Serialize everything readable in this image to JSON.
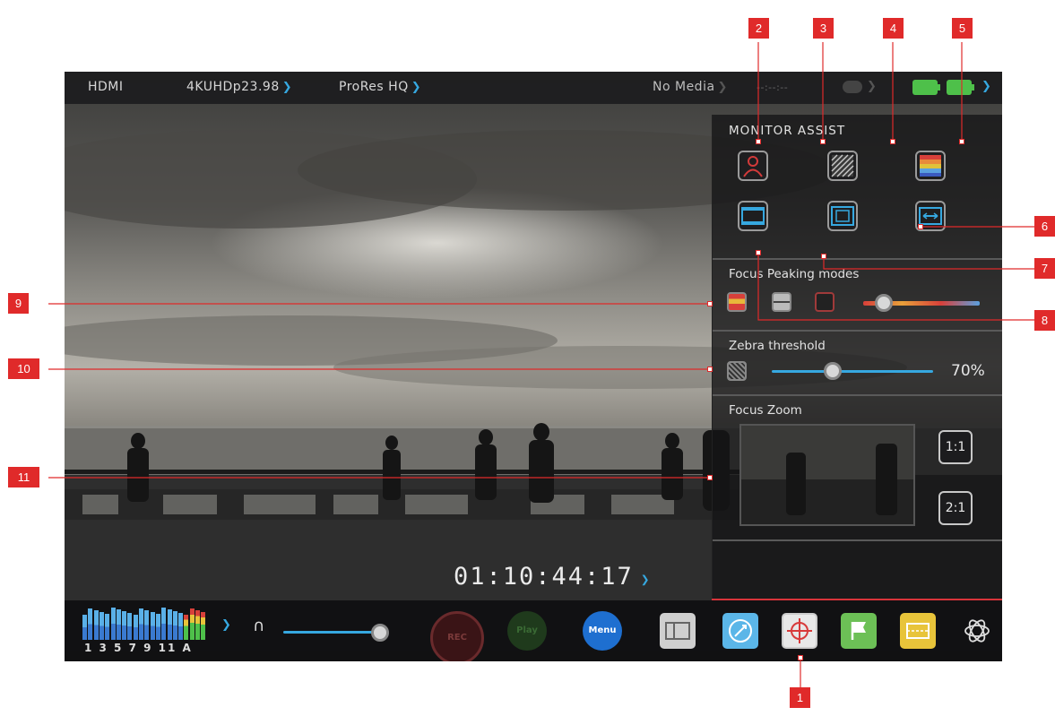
{
  "status_bar": {
    "input": "HDMI",
    "format": "4KUHDp23.98",
    "codec": "ProRes HQ",
    "media": "No Media",
    "timecode_placeholder": "--:--:--"
  },
  "monitor_assist": {
    "title": "MONITOR ASSIST",
    "focus_peaking": {
      "title": "Focus Peaking modes",
      "level": 0.18
    },
    "zebra": {
      "title": "Zebra threshold",
      "value": "70%",
      "level": 0.38
    },
    "focus_zoom": {
      "title": "Focus Zoom",
      "zoom_1": "1:1",
      "zoom_2": "2:1"
    }
  },
  "timecode": "01:10:44:17",
  "audio": {
    "channel_labels": "1 3 5 7 9 11 A",
    "headphone_level": 0.93
  },
  "bottom_buttons": {
    "record": "REC",
    "play": "Play",
    "menu": "Menu"
  },
  "callouts": [
    "1",
    "2",
    "3",
    "4",
    "5",
    "6",
    "7",
    "8",
    "9",
    "10",
    "11"
  ],
  "colors": {
    "accent_blue": "#36a8e0",
    "callout_red": "#e02a2a",
    "battery_green": "#4ec04a"
  }
}
